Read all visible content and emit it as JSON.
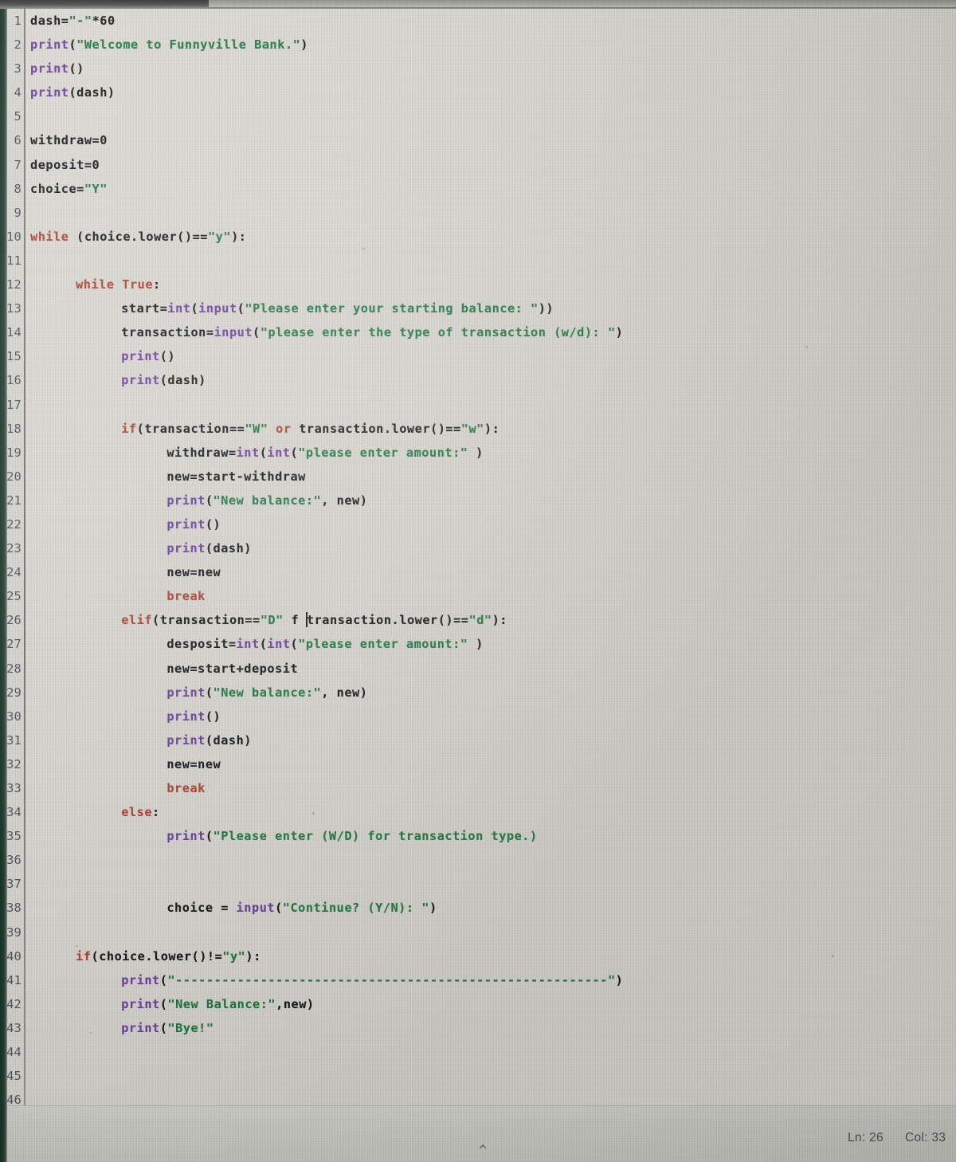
{
  "window": {
    "kind": "python-code-editor-photo",
    "language": "Python"
  },
  "editor": {
    "first_line_number": 1,
    "last_line_number": 46,
    "total_lines": 46,
    "lines": [
      {
        "n": "1",
        "indent": 0,
        "tokens": [
          {
            "t": "plain",
            "s": "dash="
          },
          {
            "t": "string",
            "s": "\"-\""
          },
          {
            "t": "plain",
            "s": "*60"
          }
        ]
      },
      {
        "n": "2",
        "indent": 0,
        "tokens": [
          {
            "t": "builtin",
            "s": "print"
          },
          {
            "t": "plain",
            "s": "("
          },
          {
            "t": "string",
            "s": "\"Welcome to Funnyville Bank.\""
          },
          {
            "t": "plain",
            "s": ")"
          }
        ]
      },
      {
        "n": "3",
        "indent": 0,
        "tokens": [
          {
            "t": "builtin",
            "s": "print"
          },
          {
            "t": "plain",
            "s": "()"
          }
        ]
      },
      {
        "n": "4",
        "indent": 0,
        "tokens": [
          {
            "t": "builtin",
            "s": "print"
          },
          {
            "t": "plain",
            "s": "(dash)"
          }
        ]
      },
      {
        "n": "5",
        "indent": 0,
        "tokens": []
      },
      {
        "n": "6",
        "indent": 0,
        "tokens": [
          {
            "t": "plain",
            "s": "withdraw=0"
          }
        ]
      },
      {
        "n": "7",
        "indent": 0,
        "tokens": [
          {
            "t": "plain",
            "s": "deposit=0"
          }
        ]
      },
      {
        "n": "8",
        "indent": 0,
        "tokens": [
          {
            "t": "plain",
            "s": "choice="
          },
          {
            "t": "string",
            "s": "\"Y\""
          }
        ]
      },
      {
        "n": "9",
        "indent": 0,
        "tokens": []
      },
      {
        "n": "10",
        "indent": 0,
        "tokens": [
          {
            "t": "keyword",
            "s": "while"
          },
          {
            "t": "plain",
            "s": " (choice.lower()=="
          },
          {
            "t": "string",
            "s": "\"y\""
          },
          {
            "t": "plain",
            "s": "):"
          }
        ]
      },
      {
        "n": "11",
        "indent": 0,
        "tokens": []
      },
      {
        "n": "12",
        "indent": 4,
        "tokens": [
          {
            "t": "keyword",
            "s": "while True"
          },
          {
            "t": "plain",
            "s": ":"
          }
        ]
      },
      {
        "n": "13",
        "indent": 8,
        "tokens": [
          {
            "t": "plain",
            "s": "start="
          },
          {
            "t": "builtin",
            "s": "int"
          },
          {
            "t": "plain",
            "s": "("
          },
          {
            "t": "builtin",
            "s": "input"
          },
          {
            "t": "plain",
            "s": "("
          },
          {
            "t": "string",
            "s": "\"Please enter your starting balance: \""
          },
          {
            "t": "plain",
            "s": "))"
          }
        ]
      },
      {
        "n": "14",
        "indent": 8,
        "tokens": [
          {
            "t": "plain",
            "s": "transaction="
          },
          {
            "t": "builtin",
            "s": "input"
          },
          {
            "t": "plain",
            "s": "("
          },
          {
            "t": "string",
            "s": "\"please enter the type of transaction (w/d): \""
          },
          {
            "t": "plain",
            "s": ")"
          }
        ]
      },
      {
        "n": "15",
        "indent": 8,
        "tokens": [
          {
            "t": "builtin",
            "s": "print"
          },
          {
            "t": "plain",
            "s": "()"
          }
        ]
      },
      {
        "n": "16",
        "indent": 8,
        "tokens": [
          {
            "t": "builtin",
            "s": "print"
          },
          {
            "t": "plain",
            "s": "(dash)"
          }
        ]
      },
      {
        "n": "17",
        "indent": 0,
        "tokens": []
      },
      {
        "n": "18",
        "indent": 8,
        "tokens": [
          {
            "t": "keyword",
            "s": "if"
          },
          {
            "t": "plain",
            "s": "(transaction=="
          },
          {
            "t": "string",
            "s": "\"W\""
          },
          {
            "t": "plain",
            "s": " "
          },
          {
            "t": "keyword",
            "s": "or"
          },
          {
            "t": "plain",
            "s": " transaction.lower()=="
          },
          {
            "t": "string",
            "s": "\"w\""
          },
          {
            "t": "plain",
            "s": "):"
          }
        ]
      },
      {
        "n": "19",
        "indent": 12,
        "tokens": [
          {
            "t": "plain",
            "s": "withdraw="
          },
          {
            "t": "builtin",
            "s": "int"
          },
          {
            "t": "plain",
            "s": "("
          },
          {
            "t": "builtin",
            "s": "int"
          },
          {
            "t": "plain",
            "s": "("
          },
          {
            "t": "string",
            "s": "\"please enter amount:\""
          },
          {
            "t": "plain",
            "s": " )"
          }
        ]
      },
      {
        "n": "20",
        "indent": 12,
        "tokens": [
          {
            "t": "plain",
            "s": "new=start-withdraw"
          }
        ]
      },
      {
        "n": "21",
        "indent": 12,
        "tokens": [
          {
            "t": "builtin",
            "s": "print"
          },
          {
            "t": "plain",
            "s": "("
          },
          {
            "t": "string",
            "s": "\"New balance:\""
          },
          {
            "t": "plain",
            "s": ", new)"
          }
        ]
      },
      {
        "n": "22",
        "indent": 12,
        "tokens": [
          {
            "t": "builtin",
            "s": "print"
          },
          {
            "t": "plain",
            "s": "()"
          }
        ]
      },
      {
        "n": "23",
        "indent": 12,
        "tokens": [
          {
            "t": "builtin",
            "s": "print"
          },
          {
            "t": "plain",
            "s": "(dash)"
          }
        ]
      },
      {
        "n": "24",
        "indent": 12,
        "tokens": [
          {
            "t": "plain",
            "s": "new=new"
          }
        ]
      },
      {
        "n": "25",
        "indent": 12,
        "tokens": [
          {
            "t": "keyword",
            "s": "break"
          }
        ]
      },
      {
        "n": "26",
        "indent": 8,
        "caret_after": "\"D\" f ",
        "tokens": [
          {
            "t": "keyword",
            "s": "elif"
          },
          {
            "t": "plain",
            "s": "(transaction=="
          },
          {
            "t": "string",
            "s": "\"D\""
          },
          {
            "t": "plain",
            "s": " f "
          },
          {
            "t": "caret",
            "s": ""
          },
          {
            "t": "plain",
            "s": "transaction.lower()=="
          },
          {
            "t": "string",
            "s": "\"d\""
          },
          {
            "t": "plain",
            "s": "):"
          }
        ]
      },
      {
        "n": "27",
        "indent": 12,
        "tokens": [
          {
            "t": "plain",
            "s": "desposit="
          },
          {
            "t": "builtin",
            "s": "int"
          },
          {
            "t": "plain",
            "s": "("
          },
          {
            "t": "builtin",
            "s": "int"
          },
          {
            "t": "plain",
            "s": "("
          },
          {
            "t": "string",
            "s": "\"please enter amount:\""
          },
          {
            "t": "plain",
            "s": " )"
          }
        ]
      },
      {
        "n": "28",
        "indent": 12,
        "tokens": [
          {
            "t": "plain",
            "s": "new=start+deposit"
          }
        ]
      },
      {
        "n": "29",
        "indent": 12,
        "tokens": [
          {
            "t": "builtin",
            "s": "print"
          },
          {
            "t": "plain",
            "s": "("
          },
          {
            "t": "string",
            "s": "\"New balance:\""
          },
          {
            "t": "plain",
            "s": ", new)"
          }
        ]
      },
      {
        "n": "30",
        "indent": 12,
        "tokens": [
          {
            "t": "builtin",
            "s": "print"
          },
          {
            "t": "plain",
            "s": "()"
          }
        ]
      },
      {
        "n": "31",
        "indent": 12,
        "tokens": [
          {
            "t": "builtin",
            "s": "print"
          },
          {
            "t": "plain",
            "s": "(dash)"
          }
        ]
      },
      {
        "n": "32",
        "indent": 12,
        "tokens": [
          {
            "t": "plain",
            "s": "new=new"
          }
        ]
      },
      {
        "n": "33",
        "indent": 12,
        "tokens": [
          {
            "t": "keyword",
            "s": "break"
          }
        ]
      },
      {
        "n": "34",
        "indent": 8,
        "tokens": [
          {
            "t": "keyword",
            "s": "else"
          },
          {
            "t": "plain",
            "s": ":"
          }
        ]
      },
      {
        "n": "35",
        "indent": 12,
        "tokens": [
          {
            "t": "builtin",
            "s": "print"
          },
          {
            "t": "plain",
            "s": "("
          },
          {
            "t": "string",
            "s": "\"Please enter (W/D) for transaction type.)"
          }
        ]
      },
      {
        "n": "36",
        "indent": 0,
        "tokens": []
      },
      {
        "n": "37",
        "indent": 0,
        "tokens": []
      },
      {
        "n": "38",
        "indent": 12,
        "tokens": [
          {
            "t": "plain",
            "s": "choice = "
          },
          {
            "t": "builtin",
            "s": "input"
          },
          {
            "t": "plain",
            "s": "("
          },
          {
            "t": "string",
            "s": "\"Continue? (Y/N): \""
          },
          {
            "t": "plain",
            "s": ")"
          }
        ]
      },
      {
        "n": "39",
        "indent": 0,
        "tokens": []
      },
      {
        "n": "40",
        "indent": 4,
        "tokens": [
          {
            "t": "keyword",
            "s": "if"
          },
          {
            "t": "plain",
            "s": "(choice.lower()!="
          },
          {
            "t": "string",
            "s": "\"y\""
          },
          {
            "t": "plain",
            "s": "):"
          }
        ]
      },
      {
        "n": "41",
        "indent": 8,
        "tokens": [
          {
            "t": "builtin",
            "s": "print"
          },
          {
            "t": "plain",
            "s": "("
          },
          {
            "t": "string",
            "s": "\"--------------------------------------------------------\""
          },
          {
            "t": "plain",
            "s": ")"
          }
        ]
      },
      {
        "n": "42",
        "indent": 8,
        "tokens": [
          {
            "t": "builtin",
            "s": "print"
          },
          {
            "t": "plain",
            "s": "("
          },
          {
            "t": "string",
            "s": "\"New Balance:\""
          },
          {
            "t": "plain",
            "s": ",new)"
          }
        ]
      },
      {
        "n": "43",
        "indent": 8,
        "tokens": [
          {
            "t": "builtin",
            "s": "print"
          },
          {
            "t": "plain",
            "s": "("
          },
          {
            "t": "string",
            "s": "\"Bye!\""
          }
        ]
      },
      {
        "n": "44",
        "indent": 0,
        "tokens": []
      },
      {
        "n": "45",
        "indent": 0,
        "tokens": []
      },
      {
        "n": "46",
        "indent": 0,
        "tokens": []
      }
    ]
  },
  "statusbar": {
    "caret_marker": "^",
    "line_label": "Ln: 26",
    "column_label": "Col: 33"
  },
  "colors": {
    "keyword": "#b0402d",
    "builtin": "#6d3fa0",
    "string": "#1d7a3f",
    "plain": "#16161a",
    "gutter_number": "#4a4f5c",
    "background": "#d7d5cf",
    "statusbar": "#c9c9c3"
  }
}
